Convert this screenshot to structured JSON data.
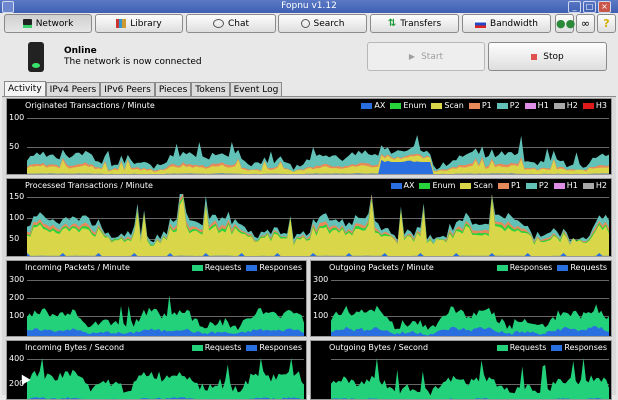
{
  "window": {
    "title": "Fopnu v1.12"
  },
  "toolbar": {
    "buttons": [
      {
        "label": "Network",
        "icon": "network-icon"
      },
      {
        "label": "Library",
        "icon": "library-icon"
      },
      {
        "label": "Chat",
        "icon": "chat-icon"
      },
      {
        "label": "Search",
        "icon": "search-icon"
      },
      {
        "label": "Transfers",
        "icon": "transfers-icon"
      },
      {
        "label": "Bandwidth",
        "icon": "bandwidth-icon"
      }
    ],
    "extra_icons": [
      "users-icon",
      "link-icon",
      "help-icon"
    ],
    "help_glyph": "?"
  },
  "status": {
    "title": "Online",
    "message": "The network is now connected",
    "start_label": "Start",
    "stop_label": "Stop"
  },
  "tabs": [
    "Activity",
    "IPv4 Peers",
    "IPv6 Peers",
    "Pieces",
    "Tokens",
    "Event Log"
  ],
  "colors": {
    "AX": "#2a6fe0",
    "Enum": "#27d43a",
    "Scan": "#d9d64a",
    "P1": "#e8895a",
    "P2": "#62c2b8",
    "H1": "#e08de8",
    "H2": "#a9a9a9",
    "H3": "#e01a1a",
    "Requests": "#22d17a",
    "Responses": "#2a6fe0"
  },
  "graphs": {
    "originated": {
      "title": "Originated Transactions / Minute",
      "legend": [
        "AX",
        "Enum",
        "Scan",
        "P1",
        "P2",
        "H1",
        "H2",
        "H3"
      ],
      "ticks": [
        "100",
        "50"
      ]
    },
    "processed": {
      "title": "Processed Transactions / Minute",
      "legend": [
        "AX",
        "Enum",
        "Scan",
        "P1",
        "P2",
        "H1",
        "H2"
      ],
      "ticks": [
        "150",
        "100",
        "50"
      ]
    },
    "incoming_packets": {
      "title": "Incoming Packets / Minute",
      "legend": [
        "Requests",
        "Responses"
      ],
      "ticks": [
        "300",
        "200",
        "100"
      ]
    },
    "outgoing_packets": {
      "title": "Outgoing Packets / Minute",
      "legend": [
        "Responses",
        "Requests"
      ],
      "ticks": [
        "300",
        "200",
        "100"
      ]
    },
    "incoming_bytes": {
      "title": "Incoming Bytes / Second",
      "legend": [
        "Requests",
        "Responses"
      ],
      "ticks": [
        "400",
        "200"
      ]
    },
    "outgoing_bytes": {
      "title": "Outgoing Bytes / Second",
      "legend": [
        "Requests",
        "Responses"
      ],
      "ticks": []
    }
  }
}
